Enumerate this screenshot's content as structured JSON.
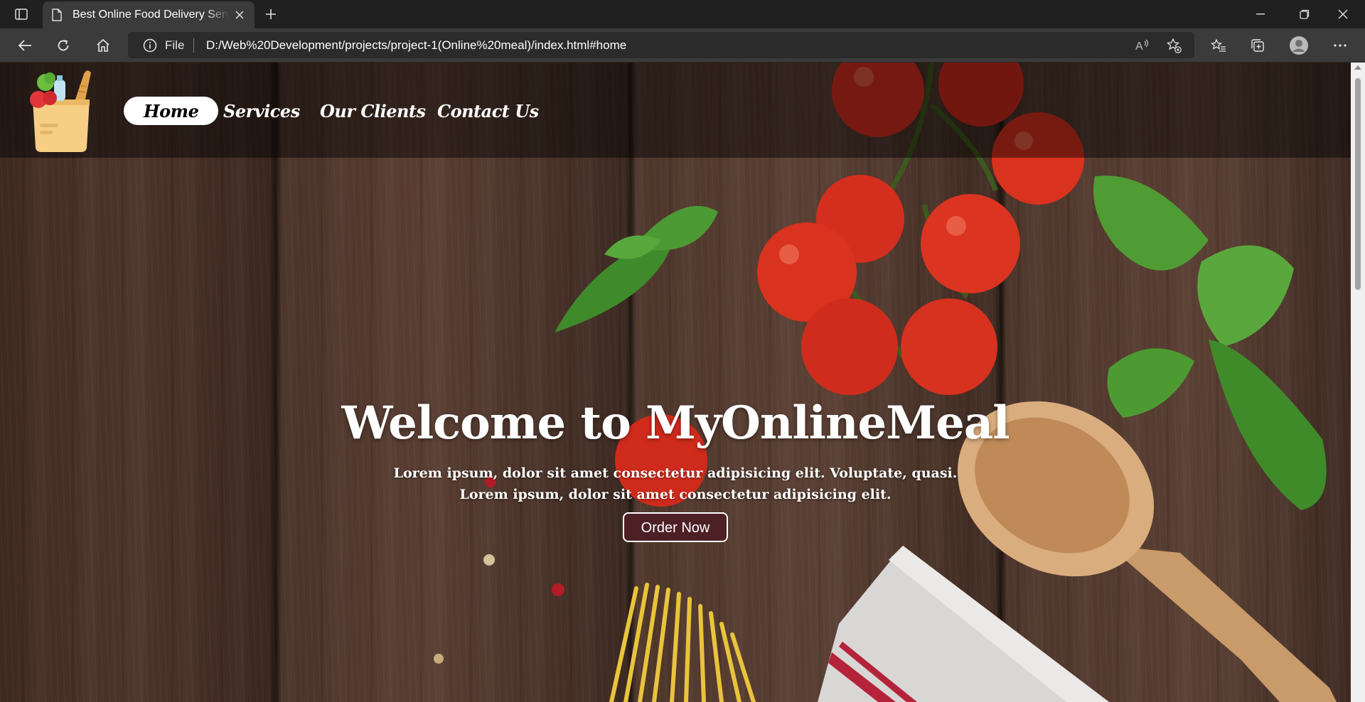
{
  "browser": {
    "tab_title": "Best Online Food Delivery Service",
    "address_scheme": "File",
    "address_url": "D:/Web%20Development/projects/project-1(Online%20meal)/index.html#home"
  },
  "nav": {
    "items": [
      {
        "label": "Home",
        "active": true
      },
      {
        "label": "Services",
        "active": false
      },
      {
        "label": "Our Clients",
        "active": false
      },
      {
        "label": "Contact Us",
        "active": false
      }
    ]
  },
  "hero": {
    "title": "Welcome to MyOnlineMeal",
    "subtitle_line1": "Lorem ipsum, dolor sit amet consectetur adipisicing elit. Voluptate, quasi.",
    "subtitle_line2": "Lorem ipsum, dolor sit amet consectetur adipisicing elit.",
    "button_label": "Order Now"
  },
  "icons": {
    "tab_actions": "tab-actions-icon",
    "page": "page-icon",
    "close": "close-icon",
    "new_tab": "plus-icon",
    "back": "back-arrow-icon",
    "refresh": "refresh-icon",
    "home": "home-icon",
    "info": "info-icon",
    "read_aloud": "read-aloud-icon",
    "add_favorite": "star-plus-icon",
    "favorites": "favorites-icon",
    "collections": "collections-icon",
    "profile": "profile-avatar-icon",
    "more": "more-dots-icon"
  },
  "colors": {
    "chrome_dark": "#202020",
    "chrome_toolbar": "#3b3b3b",
    "nav_active_bg": "#ffffff",
    "order_button_bg": "#4d2025"
  }
}
